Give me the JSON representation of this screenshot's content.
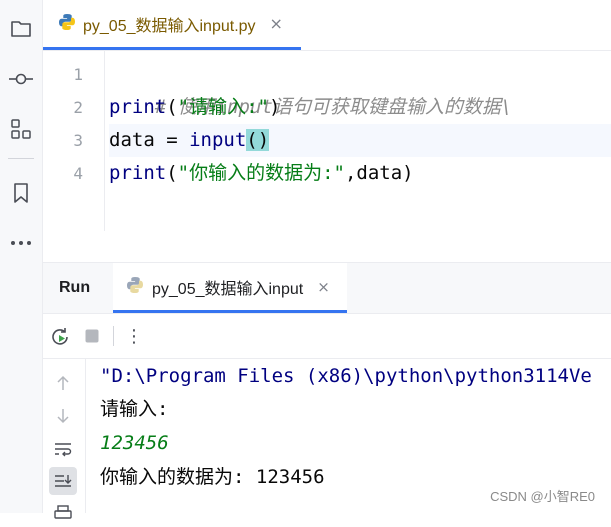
{
  "editor_tab": {
    "label": "py_05_数据输入input.py",
    "close": "×"
  },
  "code": {
    "line_numbers": [
      "1",
      "2",
      "3",
      "4"
    ],
    "line1_comment": "# 使用input语句可获取键盘输入的数据\\",
    "line2": {
      "func": "print",
      "open": "(",
      "str": "\"请输入:\"",
      "close": ")"
    },
    "line3": {
      "var": "data = ",
      "func": "input",
      "parens": "()"
    },
    "line4": {
      "func": "print",
      "open": "(",
      "str": "\"你输入的数据为:\"",
      "rest": ",data)"
    }
  },
  "run": {
    "title": "Run",
    "tab_label": "py_05_数据输入input",
    "close": "×",
    "more": "⋮"
  },
  "console": {
    "line1": "\"D:\\Program Files (x86)\\python\\python3114Ve",
    "line2": "请输入:",
    "line3": "123456",
    "line4": "你输入的数据为: 123456"
  },
  "watermark": "CSDN @小智RE0",
  "colors": {
    "accent": "#3574f0",
    "keyword": "#000080",
    "string": "#067d17",
    "comment": "#8c8c8c"
  }
}
